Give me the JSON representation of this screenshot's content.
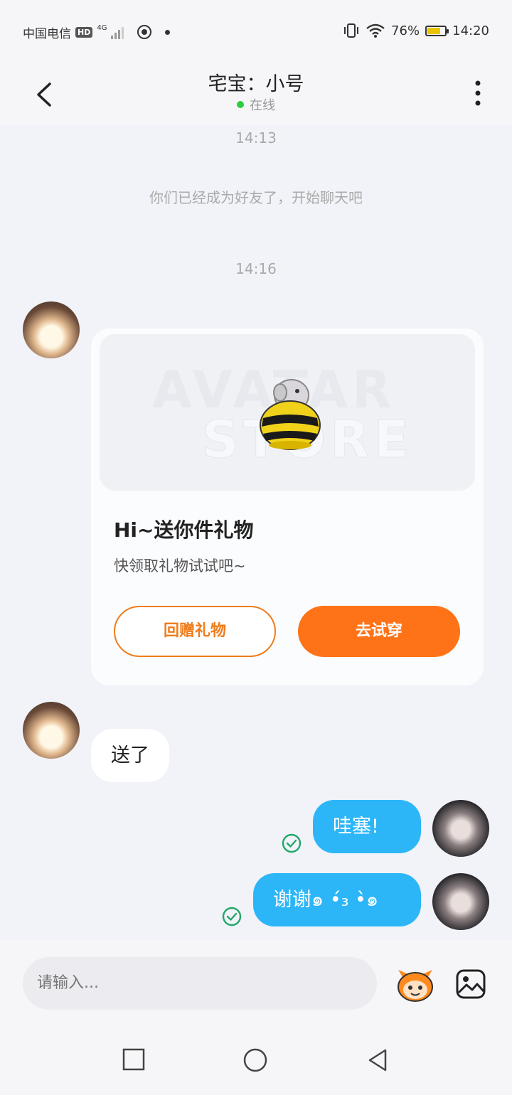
{
  "status_bar": {
    "carrier": "中国电信",
    "hd_badge": "HD",
    "network": "4G",
    "battery_percent": "76%",
    "battery_level": 0.76,
    "time": "14:20"
  },
  "header": {
    "title": "宅宝：小号",
    "status": "在线",
    "back_icon": "chevron-left-icon",
    "more_icon": "more-vertical-icon"
  },
  "chat": {
    "timestamp_1": "14:13",
    "system_message": "你们已经成为好友了，开始聊天吧",
    "timestamp_2": "14:16",
    "gift_card": {
      "watermark_line1": "AVATAR",
      "watermark_line2": "STORE",
      "title": "Hi~送你件礼物",
      "subtitle": "快领取礼物试试吧~",
      "return_gift_button": "回赠礼物",
      "try_on_button": "去试穿"
    },
    "incoming_message": "送了",
    "outgoing_messages": [
      {
        "text": "哇塞!",
        "status_icon": "check-circle-icon"
      },
      {
        "text": "谢谢๑ •́₃ •̀๑",
        "status_icon": "check-circle-icon"
      }
    ]
  },
  "input_bar": {
    "placeholder": "请输入...",
    "emoji_icon": "mascot-emoji-icon",
    "image_icon": "image-icon"
  },
  "nav_bar": {
    "recent_icon": "square-icon",
    "home_icon": "circle-icon",
    "back_icon": "triangle-back-icon"
  },
  "colors": {
    "accent_orange": "#ff7318",
    "bubble_blue": "#2cb6f8",
    "online_green": "#2ecc40",
    "check_green": "#22a86b"
  }
}
